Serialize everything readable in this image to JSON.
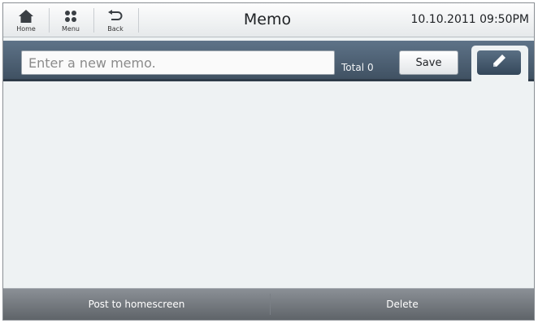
{
  "topbar": {
    "home_label": "Home",
    "menu_label": "Menu",
    "back_label": "Back",
    "title": "Memo",
    "datetime": "10.10.2011 09:50PM"
  },
  "memo": {
    "placeholder": "Enter a new memo.",
    "value": "",
    "total_label": "Total",
    "total_count": "0",
    "save_label": "Save",
    "pen_icon": "pencil-icon"
  },
  "bottom": {
    "post_label": "Post to homescreen",
    "delete_label": "Delete"
  },
  "colors": {
    "input_bar": "#4d6175",
    "content_bg": "#eef2f3",
    "bottom_bar": "#73787e"
  }
}
